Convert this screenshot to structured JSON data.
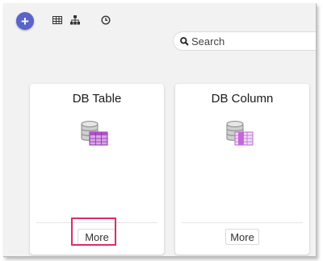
{
  "toolbar": {
    "add_label": "+",
    "view_icons": [
      "table-view-icon",
      "hierarchy-view-icon",
      "history-icon"
    ]
  },
  "search": {
    "placeholder": "Search"
  },
  "cards": [
    {
      "title": "DB Table",
      "icon": "db-table-icon",
      "more_label": "More"
    },
    {
      "title": "DB Column",
      "icon": "db-column-icon",
      "more_label": "More"
    }
  ],
  "colors": {
    "accent": "#5a63c8",
    "highlight": "#e0296a",
    "db_purple": "#b24fc9"
  }
}
